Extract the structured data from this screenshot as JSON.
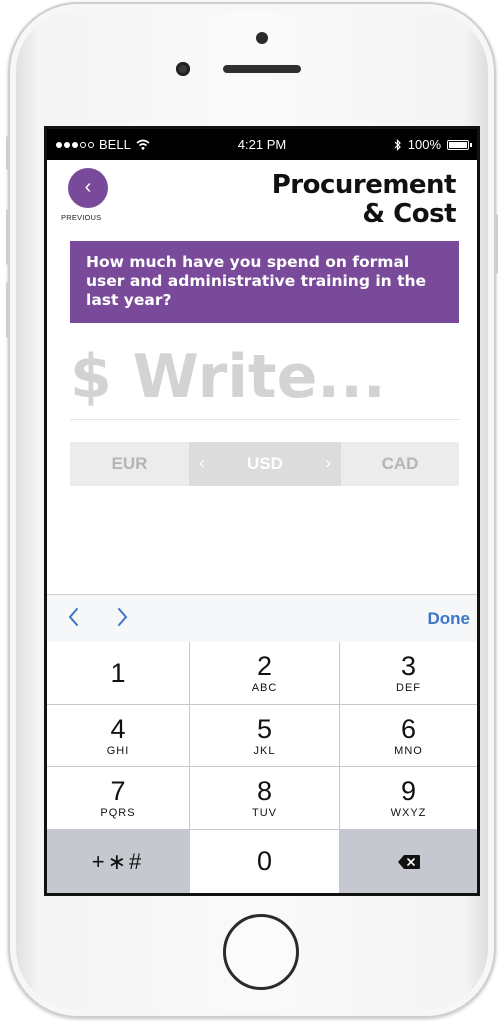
{
  "status": {
    "carrier": "BELL",
    "time": "4:21 PM",
    "battery": "100%",
    "battery_level": 1.0
  },
  "nav": {
    "previous_label": "PREVIOUS",
    "back_glyph": "‹"
  },
  "header": {
    "title_line1": "Procurement",
    "title_line2": "& Cost"
  },
  "question": {
    "text": "How much have you spend on formal user and administrative training in the last year?"
  },
  "input": {
    "placeholder": "$ Write...",
    "value": ""
  },
  "currency": {
    "options": [
      "EUR",
      "USD",
      "CAD"
    ],
    "selected": "USD",
    "left_arrow": "‹",
    "right_arrow": "›"
  },
  "toolbar": {
    "prev_glyph": "‹",
    "next_glyph": "›",
    "done_label": "Done"
  },
  "keypad": {
    "keys": [
      {
        "num": "1",
        "letters": ""
      },
      {
        "num": "2",
        "letters": "ABC"
      },
      {
        "num": "3",
        "letters": "DEF"
      },
      {
        "num": "4",
        "letters": "GHI"
      },
      {
        "num": "5",
        "letters": "JKL"
      },
      {
        "num": "6",
        "letters": "MNO"
      },
      {
        "num": "7",
        "letters": "PQRS"
      },
      {
        "num": "8",
        "letters": "TUV"
      },
      {
        "num": "9",
        "letters": "WXYZ"
      }
    ],
    "symbols_label": "+∗#",
    "zero": "0"
  },
  "icons": {
    "wifi": "wifi-icon",
    "bluetooth": "bluetooth-icon",
    "battery": "battery-icon",
    "backspace": "backspace-icon"
  },
  "colors": {
    "accent": "#7a4a9a",
    "link": "#3c76c8",
    "keyboard_bg": "#c5c9cf"
  }
}
